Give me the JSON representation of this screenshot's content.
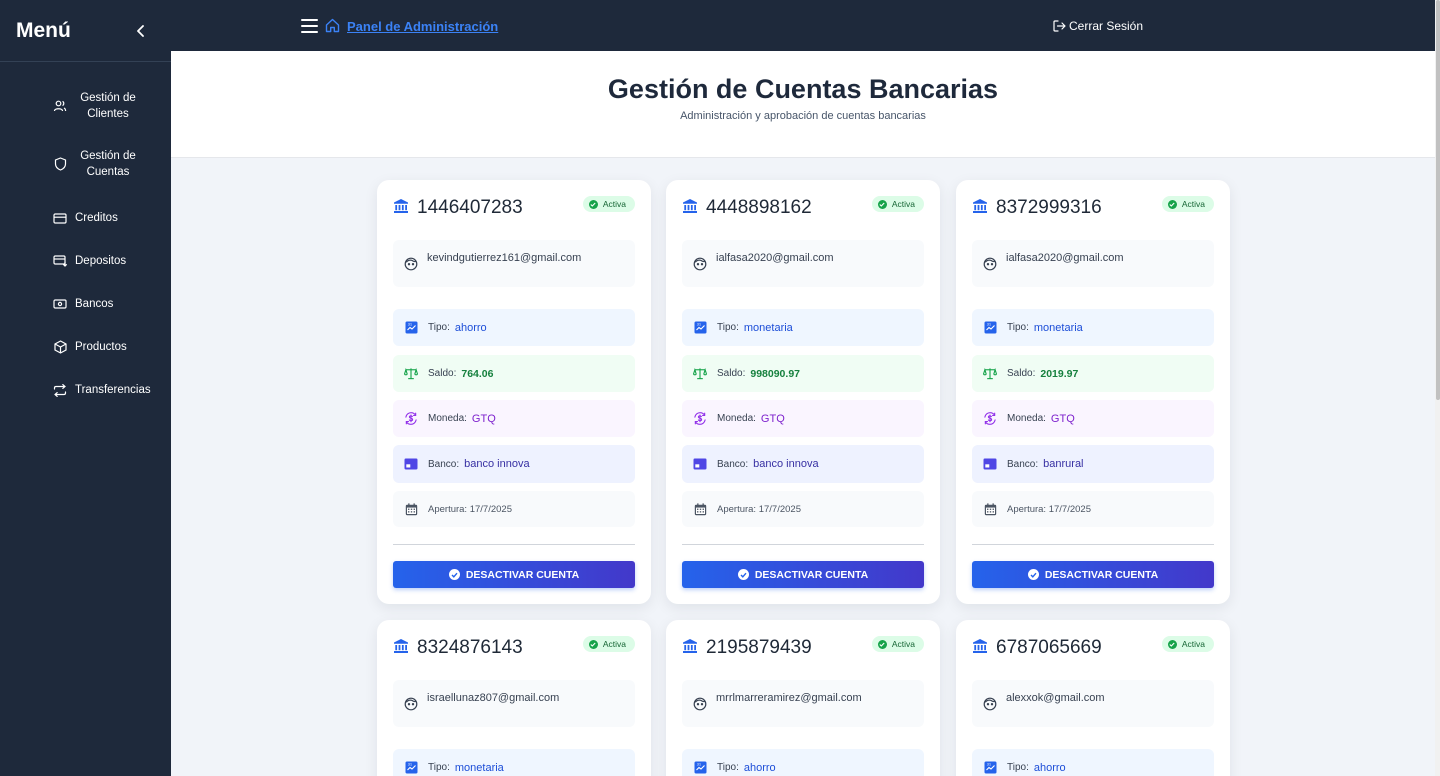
{
  "sidebar": {
    "title": "Menú",
    "items": [
      {
        "label": "Gestión de Clientes",
        "icon": "users-icon"
      },
      {
        "label": "Gestión de Cuentas",
        "icon": "shield-icon"
      },
      {
        "label": "Creditos",
        "icon": "credit-card-icon"
      },
      {
        "label": "Depositos",
        "icon": "deposit-icon"
      },
      {
        "label": "Bancos",
        "icon": "banknote-icon"
      },
      {
        "label": "Productos",
        "icon": "package-icon"
      },
      {
        "label": "Transferencias",
        "icon": "transfer-arrows-icon"
      }
    ]
  },
  "topbar": {
    "admin_link": "Panel de Administración",
    "logout": "Cerrar Sesión"
  },
  "header": {
    "title": "Gestión de Cuentas Bancarias",
    "subtitle": "Administración y aprobación de cuentas bancarias"
  },
  "labels": {
    "tipo": "Tipo:",
    "saldo": "Saldo:",
    "moneda": "Moneda:",
    "banco": "Banco:",
    "apertura": "Apertura:",
    "button": "DESACTIVAR CUENTA"
  },
  "colors": {
    "sidebar_bg": "#1e293b",
    "accent": "#2563eb",
    "button_gradient_end": "#4338ca",
    "active_badge_bg": "#dcfce7",
    "active_badge_text": "#166534"
  },
  "accounts": [
    {
      "number": "1446407283",
      "status": "Activa",
      "email": "kevindgutierrez161@gmail.com",
      "tipo": "ahorro",
      "saldo": "764.06",
      "moneda": "GTQ",
      "banco": "banco innova",
      "apertura": "17/7/2025"
    },
    {
      "number": "4448898162",
      "status": "Activa",
      "email": "ialfasa2020@gmail.com",
      "tipo": "monetaria",
      "saldo": "998090.97",
      "moneda": "GTQ",
      "banco": "banco innova",
      "apertura": "17/7/2025"
    },
    {
      "number": "8372999316",
      "status": "Activa",
      "email": "ialfasa2020@gmail.com",
      "tipo": "monetaria",
      "saldo": "2019.97",
      "moneda": "GTQ",
      "banco": "banrural",
      "apertura": "17/7/2025"
    },
    {
      "number": "8324876143",
      "status": "Activa",
      "email": "israellunaz807@gmail.com",
      "tipo": "monetaria"
    },
    {
      "number": "2195879439",
      "status": "Activa",
      "email": "mrrlmarreramirez@gmail.com",
      "tipo": "ahorro"
    },
    {
      "number": "6787065669",
      "status": "Activa",
      "email": "alexxok@gmail.com",
      "tipo": "ahorro"
    }
  ]
}
